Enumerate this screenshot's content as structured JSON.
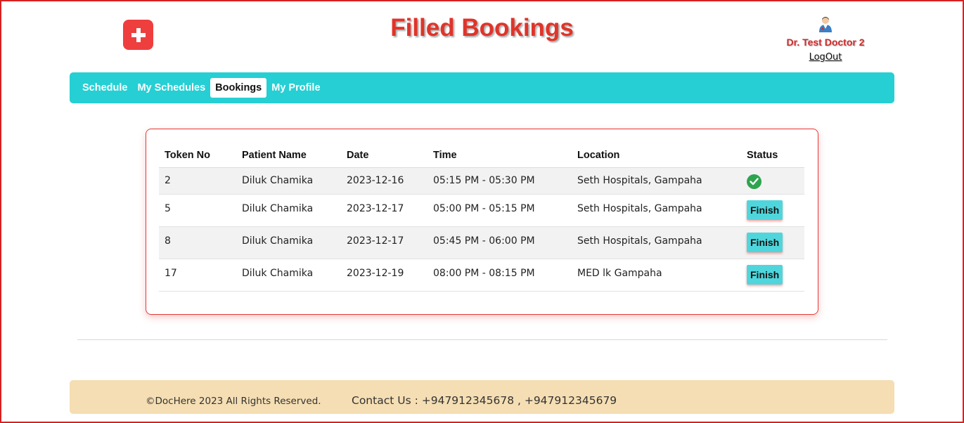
{
  "header": {
    "title": "Filled Bookings",
    "doctor_name": "Dr. Test Doctor 2",
    "logout_label": "LogOut"
  },
  "nav": {
    "items": [
      {
        "label": "Schedule"
      },
      {
        "label": "My Schedules"
      },
      {
        "label": "Bookings"
      },
      {
        "label": "My Profile"
      }
    ],
    "active": "Bookings"
  },
  "table": {
    "columns": [
      "Token No",
      "Patient Name",
      "Date",
      "Time",
      "Location",
      "Status"
    ],
    "rows": [
      {
        "token": "2",
        "patient": "Diluk Chamika",
        "date": "2023-12-16",
        "time": "05:15 PM - 05:30 PM",
        "location": "Seth Hospitals, Gampaha",
        "status": "finished"
      },
      {
        "token": "5",
        "patient": "Diluk Chamika",
        "date": "2023-12-17",
        "time": "05:00 PM - 05:15 PM",
        "location": "Seth Hospitals, Gampaha",
        "status": "pending",
        "action_label": "Finish"
      },
      {
        "token": "8",
        "patient": "Diluk Chamika",
        "date": "2023-12-17",
        "time": "05:45 PM - 06:00 PM",
        "location": "Seth Hospitals, Gampaha",
        "status": "pending",
        "action_label": "Finish"
      },
      {
        "token": "17",
        "patient": "Diluk Chamika",
        "date": "2023-12-19",
        "time": "08:00 PM - 08:15 PM",
        "location": "MED lk Gampaha",
        "status": "pending",
        "action_label": "Finish"
      }
    ]
  },
  "footer": {
    "copyright": "©DocHere 2023 All Rights Reserved.",
    "contact": "Contact Us : +947912345678 , +947912345679"
  },
  "colors": {
    "accent": "#26cfd3",
    "title_red": "#e0342a",
    "border_red": "#e53935",
    "footer_bg": "#f5deb3",
    "success_green": "#2ea44f"
  },
  "icons": {
    "logo": "medical-cross-icon",
    "avatar": "doctor-avatar-icon",
    "status_done": "check-circle-icon"
  }
}
